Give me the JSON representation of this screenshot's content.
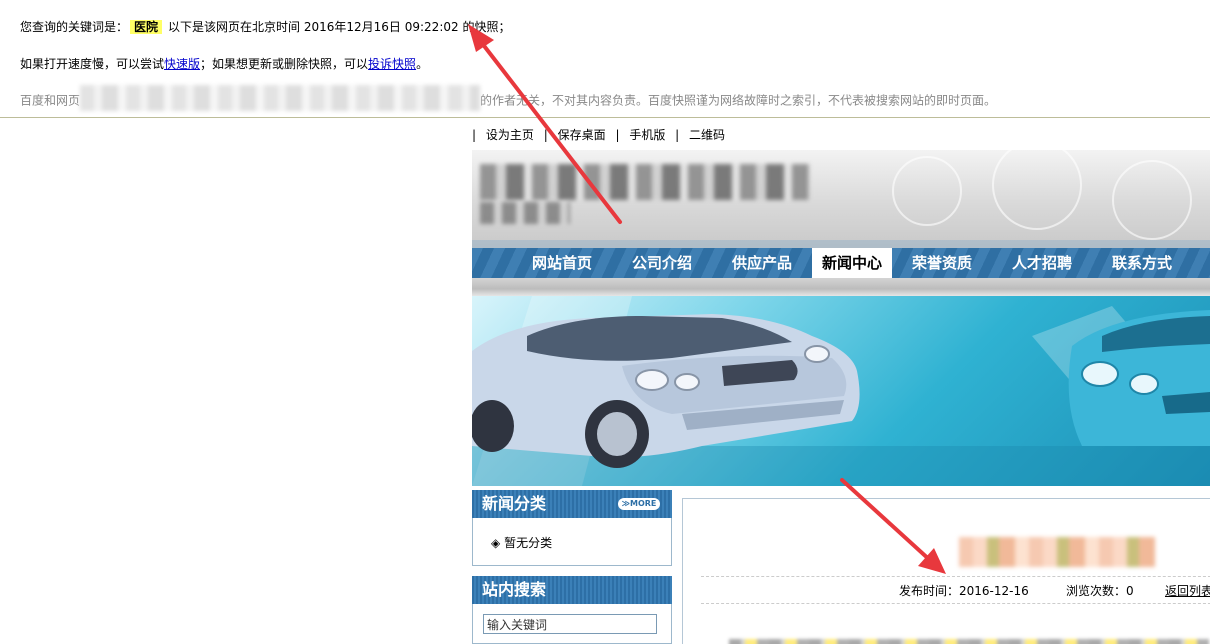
{
  "snapshot": {
    "line1_prefix": "您查询的关键词是：",
    "keyword": "医院",
    "line1_suffix": "以下是该网页在北京时间 2016年12月16日 09:22:02 的快照；",
    "line2_a": "如果打开速度慢，可以尝试",
    "fast_link": "快速版",
    "line2_b": "；如果想更新或删除快照，可以",
    "complain_link": "投诉快照",
    "line2_c": "。",
    "line3_a": "百度和网页",
    "line3_b": "的作者无关，不对其内容负责。百度快照谨为网络故障时之索引，不代表被搜索网站的即时页面。"
  },
  "site": {
    "topbar": {
      "items": [
        "设为主页",
        "保存桌面",
        "手机版",
        "二维码"
      ],
      "separator": "|"
    },
    "nav": {
      "items": [
        "网站首页",
        "公司介绍",
        "供应产品",
        "新闻中心",
        "荣誉资质",
        "人才招聘",
        "联系方式"
      ],
      "active_index": 3
    },
    "sidebar": {
      "news_category_title": "新闻分类",
      "more_label": "≫MORE",
      "news_category_item": "暂无分类",
      "search_title": "站内搜索",
      "search_placeholder": "输入关键词"
    },
    "article": {
      "publish_label": "发布时间：2016-12-16",
      "views_label": "浏览次数：0",
      "back_link": "返回列表"
    }
  },
  "colors": {
    "keyword_highlight": "#ffff66",
    "nav_blue": "#3b7db3",
    "annotation_arrow": "#e8383d",
    "link_blue": "#0000cc"
  }
}
